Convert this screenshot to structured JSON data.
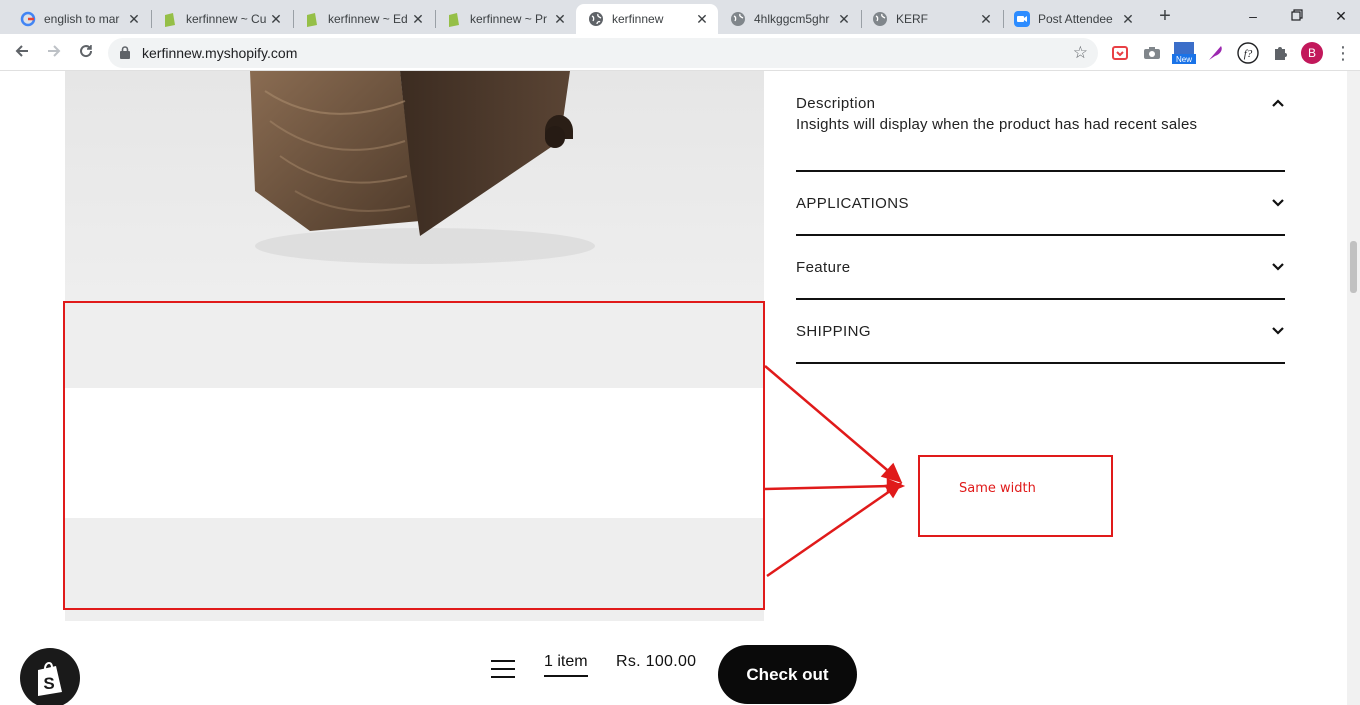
{
  "browser": {
    "tabs": [
      {
        "title": "english to mar",
        "icon": "google-icon"
      },
      {
        "title": "kerfinnew ~ Cu",
        "icon": "shopify-icon"
      },
      {
        "title": "kerfinnew ~ Ed",
        "icon": "shopify-icon"
      },
      {
        "title": "kerfinnew ~ Pr",
        "icon": "shopify-icon"
      },
      {
        "title": "kerfinnew",
        "icon": "globe-icon",
        "active": true
      },
      {
        "title": "4hlkggcm5ghr",
        "icon": "globe-icon"
      },
      {
        "title": "KERF",
        "icon": "globe-icon"
      },
      {
        "title": "Post Attendee",
        "icon": "zoom-icon"
      }
    ],
    "url": "kerfinnew.myshopify.com",
    "profile_initial": "B",
    "new_badge": "New"
  },
  "product": {
    "accordion": [
      {
        "title": "Description",
        "expanded": true,
        "body": "Insights will display when the product has had recent sales"
      },
      {
        "title": "APPLICATIONS",
        "expanded": false
      },
      {
        "title": "Feature",
        "expanded": false
      },
      {
        "title": "SHIPPING",
        "expanded": false
      }
    ]
  },
  "annotation": {
    "label": "Same width",
    "color": "#e01a1a"
  },
  "cart": {
    "count_label": "1 item",
    "price": "Rs. 100.00",
    "checkout_label": "Check out"
  }
}
